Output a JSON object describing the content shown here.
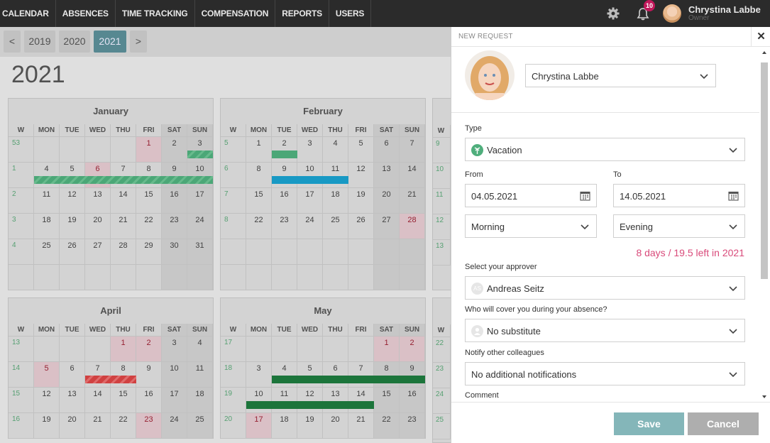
{
  "nav": {
    "items": [
      "CALENDAR",
      "ABSENCES",
      "TIME TRACKING",
      "COMPENSATION",
      "REPORTS",
      "USERS"
    ],
    "notification_count": "10",
    "user_name": "Chrystina Labbe",
    "user_role": "Owner"
  },
  "yearbar": {
    "prev": "<",
    "years": [
      "2019",
      "2020",
      "2021"
    ],
    "active_year": "2021",
    "next": ">"
  },
  "page_title": "2021",
  "weekday_headers": [
    "W",
    "MON",
    "TUE",
    "WED",
    "THU",
    "FRI",
    "SAT",
    "SUN"
  ],
  "months": [
    {
      "name": "January",
      "weeks": [
        {
          "w": "53",
          "days": [
            "",
            "",
            "",
            "",
            "1",
            "2",
            "3"
          ]
        },
        {
          "w": "1",
          "days": [
            "4",
            "5",
            "6",
            "7",
            "8",
            "9",
            "10"
          ]
        },
        {
          "w": "2",
          "days": [
            "11",
            "12",
            "13",
            "14",
            "15",
            "16",
            "17"
          ]
        },
        {
          "w": "3",
          "days": [
            "18",
            "19",
            "20",
            "21",
            "22",
            "23",
            "24"
          ]
        },
        {
          "w": "4",
          "days": [
            "25",
            "26",
            "27",
            "28",
            "29",
            "30",
            "31"
          ]
        },
        {
          "w": "",
          "days": [
            "",
            "",
            "",
            "",
            "",
            "",
            ""
          ]
        }
      ]
    },
    {
      "name": "February",
      "weeks": [
        {
          "w": "5",
          "days": [
            "1",
            "2",
            "3",
            "4",
            "5",
            "6",
            "7"
          ]
        },
        {
          "w": "6",
          "days": [
            "8",
            "9",
            "10",
            "11",
            "12",
            "13",
            "14"
          ]
        },
        {
          "w": "7",
          "days": [
            "15",
            "16",
            "17",
            "18",
            "19",
            "20",
            "21"
          ]
        },
        {
          "w": "8",
          "days": [
            "22",
            "23",
            "24",
            "25",
            "26",
            "27",
            "28"
          ]
        },
        {
          "w": "",
          "days": [
            "",
            "",
            "",
            "",
            "",
            "",
            ""
          ]
        },
        {
          "w": "",
          "days": [
            "",
            "",
            "",
            "",
            "",
            "",
            ""
          ]
        }
      ]
    },
    {
      "name": "April",
      "weeks": [
        {
          "w": "13",
          "days": [
            "",
            "",
            "",
            "1",
            "2",
            "3",
            "4"
          ]
        },
        {
          "w": "14",
          "days": [
            "5",
            "6",
            "7",
            "8",
            "9",
            "10",
            "11"
          ]
        },
        {
          "w": "15",
          "days": [
            "12",
            "13",
            "14",
            "15",
            "16",
            "17",
            "18"
          ]
        },
        {
          "w": "16",
          "days": [
            "19",
            "20",
            "21",
            "22",
            "23",
            "24",
            "25"
          ]
        }
      ]
    },
    {
      "name": "May",
      "weeks": [
        {
          "w": "17",
          "days": [
            "",
            "",
            "",
            "",
            "",
            "1",
            "2"
          ]
        },
        {
          "w": "18",
          "days": [
            "3",
            "4",
            "5",
            "6",
            "7",
            "8",
            "9"
          ]
        },
        {
          "w": "19",
          "days": [
            "10",
            "11",
            "12",
            "13",
            "14",
            "15",
            "16"
          ]
        },
        {
          "w": "20",
          "days": [
            "17",
            "18",
            "19",
            "20",
            "21",
            "22",
            "23"
          ]
        }
      ]
    }
  ],
  "partial_weeks_right": [
    "9",
    "10",
    "11",
    "12",
    "13",
    "22",
    "23",
    "24",
    "25"
  ],
  "panel": {
    "title": "NEW REQUEST",
    "close": "✕",
    "employee": "Chrystina Labbe",
    "type_label": "Type",
    "type_value": "Vacation",
    "from_label": "From",
    "to_label": "To",
    "from_date": "04.05.2021",
    "to_date": "14.05.2021",
    "from_part": "Morning",
    "to_part": "Evening",
    "summary": "8 days / 19.5 left in 2021",
    "approver_label": "Select your approver",
    "approver_initials": "AS",
    "approver_value": "Andreas Seitz",
    "substitute_label": "Who will cover you during your absence?",
    "substitute_value": "No substitute",
    "notify_label": "Notify other colleagues",
    "notify_value": "No additional notifications",
    "comment_label": "Comment",
    "save": "Save",
    "cancel": "Cancel"
  },
  "colors": {
    "accent": "#5b8e97",
    "pink": "#d94a7a",
    "green": "#4fae7c",
    "dark_green": "#1e7a3e",
    "blue": "#1aa0cc",
    "red_hatch": "#d94444"
  }
}
